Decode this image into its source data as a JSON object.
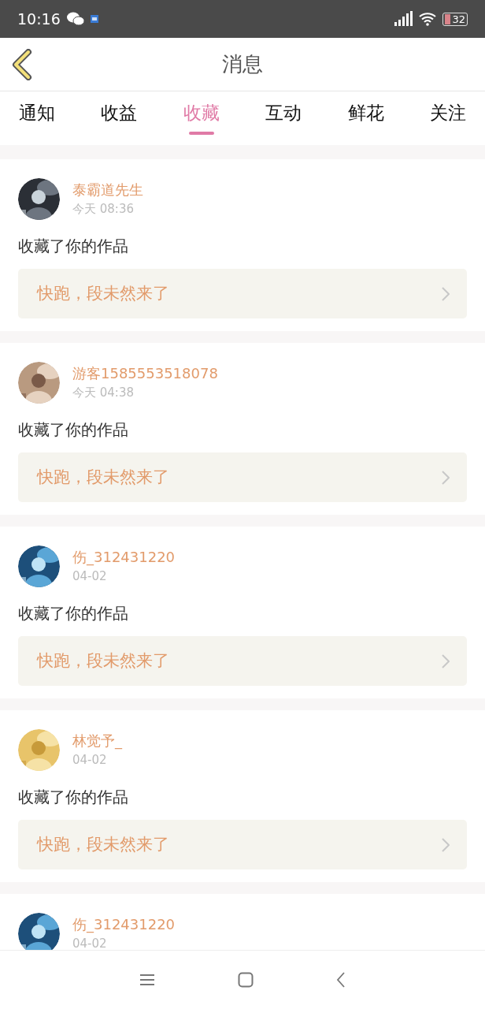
{
  "status_bar": {
    "time": "10:16",
    "battery": "32"
  },
  "header": {
    "title": "消息"
  },
  "tabs": [
    {
      "label": "通知",
      "selected": false
    },
    {
      "label": "收益",
      "selected": false
    },
    {
      "label": "收藏",
      "selected": true
    },
    {
      "label": "互动",
      "selected": false
    },
    {
      "label": "鲜花",
      "selected": false
    },
    {
      "label": "关注",
      "selected": false
    }
  ],
  "messages": [
    {
      "user": "泰霸道先生",
      "time": "今天 08:36",
      "action": "收藏了你的作品",
      "work": "快跑，段未然来了"
    },
    {
      "user": "游客1585553518078",
      "time": "今天 04:38",
      "action": "收藏了你的作品",
      "work": "快跑，段未然来了"
    },
    {
      "user": "伤_312431220",
      "time": "04-02",
      "action": "收藏了你的作品",
      "work": "快跑，段未然来了"
    },
    {
      "user": "林觉予_",
      "time": "04-02",
      "action": "收藏了你的作品",
      "work": "快跑，段未然来了"
    },
    {
      "user": "伤_312431220",
      "time": "04-02"
    }
  ]
}
